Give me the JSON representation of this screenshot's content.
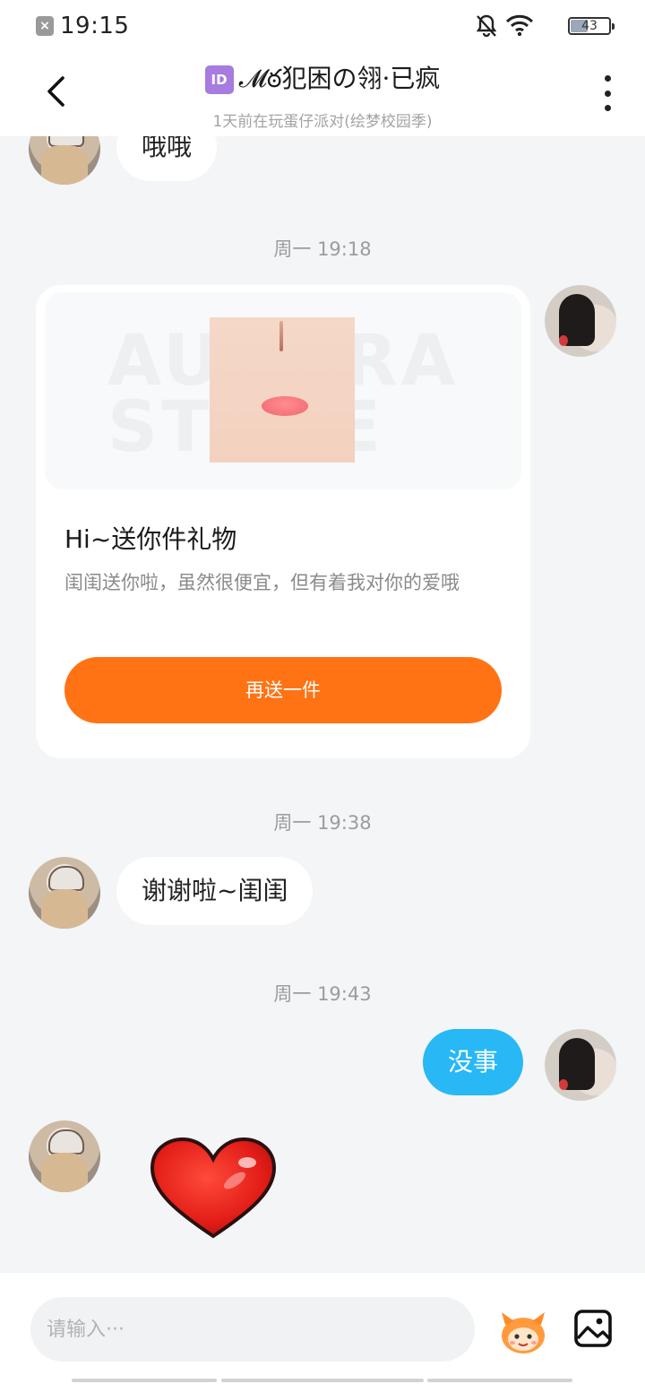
{
  "status_bar": {
    "time": "19:15",
    "battery_level": "43",
    "battery_fraction": 0.43,
    "icons": [
      "app-notification-icon",
      "bell-muted-icon",
      "wifi-icon",
      "battery-icon"
    ]
  },
  "header": {
    "id_badge": "ID",
    "title": "𝓜ఠ犯困の翎·已疯",
    "subtitle": "1天前在玩蛋仔派对(绘梦校园季)"
  },
  "messages": {
    "m1_text": "哦哦",
    "time1": "周一 19:18",
    "gift": {
      "watermark": "AURORA STORE",
      "title": "Hi~送你件礼物",
      "description": "闺闺送你啦，虽然很便宜，但有着我对你的爱哦",
      "button_label": "再送一件"
    },
    "time2": "周一 19:38",
    "m2_text": "谢谢啦~闺闺",
    "time3": "周一 19:43",
    "m3_text": "没事",
    "sticker": "heart-sticker"
  },
  "input": {
    "placeholder": "请输入···"
  },
  "colors": {
    "accent_orange": "#ff7314",
    "outgoing_bubble": "#27b8f5",
    "background": "#f3f5f7"
  }
}
